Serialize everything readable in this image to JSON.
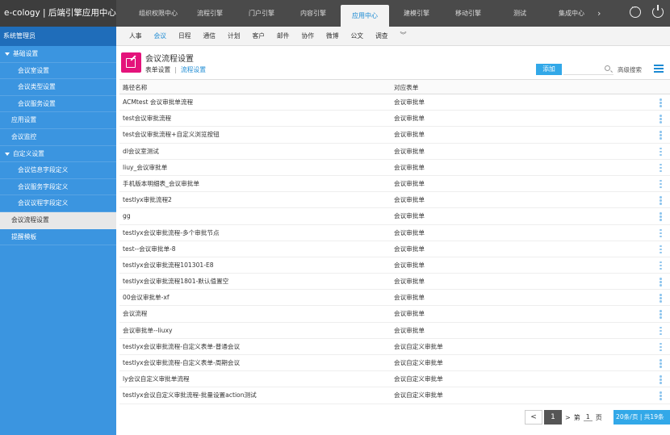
{
  "app": {
    "brand": "e-cology | 后端引擎应用中心"
  },
  "topnav": {
    "items": [
      "组织权限中心",
      "流程引擎",
      "门户引擎",
      "内容引擎",
      "应用中心",
      "建模引擎",
      "移动引擎",
      "测试",
      "集成中心"
    ],
    "active_index": 4
  },
  "sidebar": {
    "header": "系统管理员",
    "items": [
      {
        "label": "基础设置",
        "level": "group"
      },
      {
        "label": "会议室设置",
        "level": "child"
      },
      {
        "label": "会议类型设置",
        "level": "child"
      },
      {
        "label": "会议服务设置",
        "level": "child"
      },
      {
        "label": "应用设置",
        "level": "top"
      },
      {
        "label": "会议监控",
        "level": "top"
      },
      {
        "label": "自定义设置",
        "level": "group"
      },
      {
        "label": "会议信息字段定义",
        "level": "child"
      },
      {
        "label": "会议服务字段定义",
        "level": "child"
      },
      {
        "label": "会议议程字段定义",
        "level": "child"
      },
      {
        "label": "会议流程设置",
        "level": "active"
      },
      {
        "label": "提醒模板",
        "level": "top"
      }
    ]
  },
  "subnav": {
    "items": [
      "人事",
      "会议",
      "日程",
      "通信",
      "计划",
      "客户",
      "邮件",
      "协作",
      "微博",
      "公文",
      "调查"
    ],
    "active_index": 1
  },
  "page": {
    "title": "会议流程设置",
    "tab_form": "表单设置",
    "tab_separator": "|",
    "tab_flow": "流程设置",
    "add_label": "添加",
    "advanced_search": "高级搜索"
  },
  "table": {
    "headers": [
      "路径名称",
      "对应表单"
    ],
    "rows": [
      [
        "ACMtest 会议审批单流程",
        "会议审批单"
      ],
      [
        "test会议审批流程",
        "会议审批单"
      ],
      [
        "test会议审批流程+自定义浏览按钮",
        "会议审批单"
      ],
      [
        "dl会议室测试",
        "会议审批单"
      ],
      [
        "liuy_会议审批单",
        "会议审批单"
      ],
      [
        "手机版本明细表_会议审批单",
        "会议审批单"
      ],
      [
        "testlyx审批流程2",
        "会议审批单"
      ],
      [
        "gg",
        "会议审批单"
      ],
      [
        "testlyx会议审批流程-多个审批节点",
        "会议审批单"
      ],
      [
        "test--会议审批单-8",
        "会议审批单"
      ],
      [
        "testlyx会议审批流程101301-E8",
        "会议审批单"
      ],
      [
        "testlyx会议审批流程1801-默认值置空",
        "会议审批单"
      ],
      [
        "00会议审批单-xf",
        "会议审批单"
      ],
      [
        "会议流程",
        "会议审批单"
      ],
      [
        "会议审批单--liuxy",
        "会议审批单"
      ],
      [
        "testlyx会议审批流程-自定义表单-普通会议",
        "会议自定义审批单"
      ],
      [
        "testlyx会议审批流程-自定义表单-周期会议",
        "会议自定义审批单"
      ],
      [
        "ly会议自定义审批单流程",
        "会议自定义审批单"
      ],
      [
        "testlyx会议自定义审批流程-批量设置action测试",
        "会议自定义审批单"
      ]
    ]
  },
  "pager": {
    "prev": "<",
    "current": "1",
    "next": ">",
    "page_label_pre": "第",
    "page_input": "1",
    "page_label_post": "页",
    "summary": "20条/页 | 共19条"
  },
  "colors": {
    "topbar": "#4a4a4a",
    "sidebar": "#3b95e0",
    "accent": "#1b8ad3",
    "page_icon": "#e4137b",
    "add_button": "#32a8e8"
  }
}
